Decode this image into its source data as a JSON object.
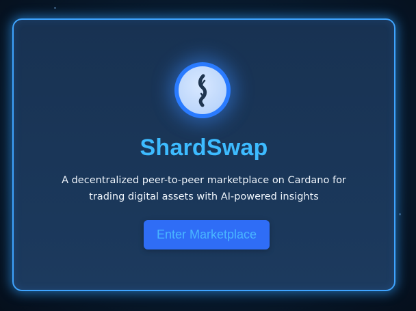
{
  "app": {
    "title": "ShardSwap",
    "tagline": "A decentralized peer-to-peer marketplace on Cardano for trading digital assets with AI-powered insights"
  },
  "logo": {
    "icon": "shard-swirl-icon"
  },
  "cta": {
    "label": "Enter Marketplace"
  },
  "colors": {
    "accent": "#3dbbff",
    "border": "#3fa4ff",
    "button": "#2f6df6",
    "card": "#1c3a5e",
    "background": "#081a2d"
  }
}
